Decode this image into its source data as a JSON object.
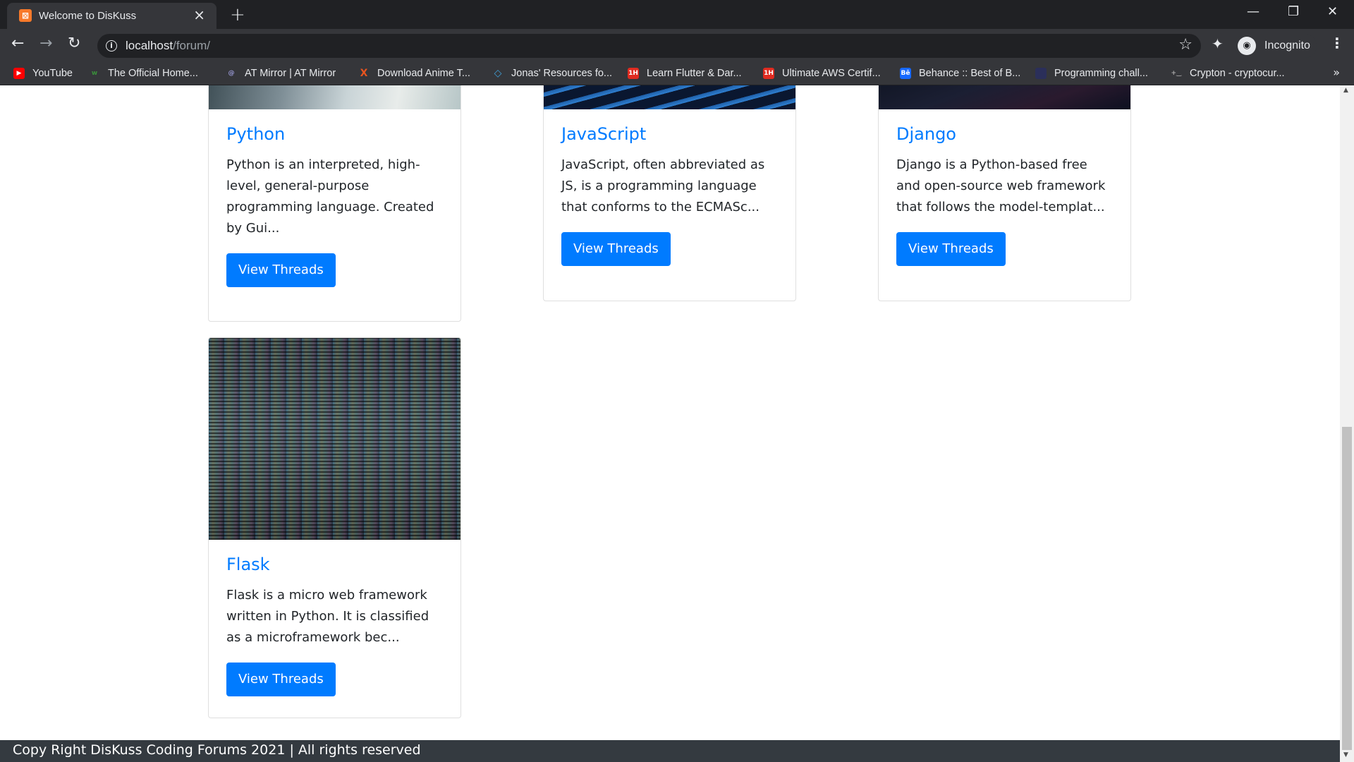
{
  "browser": {
    "tab": {
      "title": "Welcome to DisKuss",
      "favicon": "xampp-icon"
    },
    "new_tab_icon": "+",
    "address": {
      "host": "localhost",
      "path": "/forum/"
    },
    "profile_label": "Incognito",
    "bookmarks": [
      {
        "label": "YouTube",
        "icon": "youtube-icon",
        "color": "#ff0000"
      },
      {
        "label": "The Official Home...",
        "icon": "wd-icon",
        "color": "#3a8f3a"
      },
      {
        "label": "AT Mirror | AT Mirror",
        "icon": "at-icon",
        "color": "#6a6ab0"
      },
      {
        "label": "Download Anime T...",
        "icon": "x-icon",
        "color": "#e8541f"
      },
      {
        "label": "Jonas' Resources fo...",
        "icon": "diamond-icon",
        "color": "#3fa0d8"
      },
      {
        "label": "Learn Flutter & Dar...",
        "icon": "1h-icon",
        "color": "#e02b20"
      },
      {
        "label": "Ultimate AWS Certif...",
        "icon": "1h-icon",
        "color": "#e02b20"
      },
      {
        "label": "Behance :: Best of B...",
        "icon": "behance-icon",
        "color": "#1769ff"
      },
      {
        "label": "Programming chall...",
        "icon": "blank-icon",
        "color": "#2b2f5a"
      },
      {
        "label": "Crypton - cryptocur...",
        "icon": "crypton-icon",
        "color": "#555555"
      }
    ]
  },
  "categories": [
    {
      "title": "Python",
      "description": "Python is an interpreted, high-level, general-purpose programming language. Created by Gui...",
      "button_label": "View Threads"
    },
    {
      "title": "JavaScript",
      "description": "JavaScript, often abbreviated as JS, is a programming language that conforms to the ECMASc...",
      "button_label": "View Threads"
    },
    {
      "title": "Django",
      "description": "Django is a Python-based free and open-source web framework that follows the model-templat...",
      "button_label": "View Threads"
    },
    {
      "title": "Flask",
      "description": "Flask is a micro web framework written in Python. It is classified as a microframework bec...",
      "button_label": "View Threads"
    }
  ],
  "footer": {
    "text": "Copy Right DisKuss Coding Forums 2021 | All rights reserved"
  },
  "colors": {
    "accent": "#007bff",
    "footer_bg": "#343a40",
    "chrome_bg": "#35363a"
  }
}
